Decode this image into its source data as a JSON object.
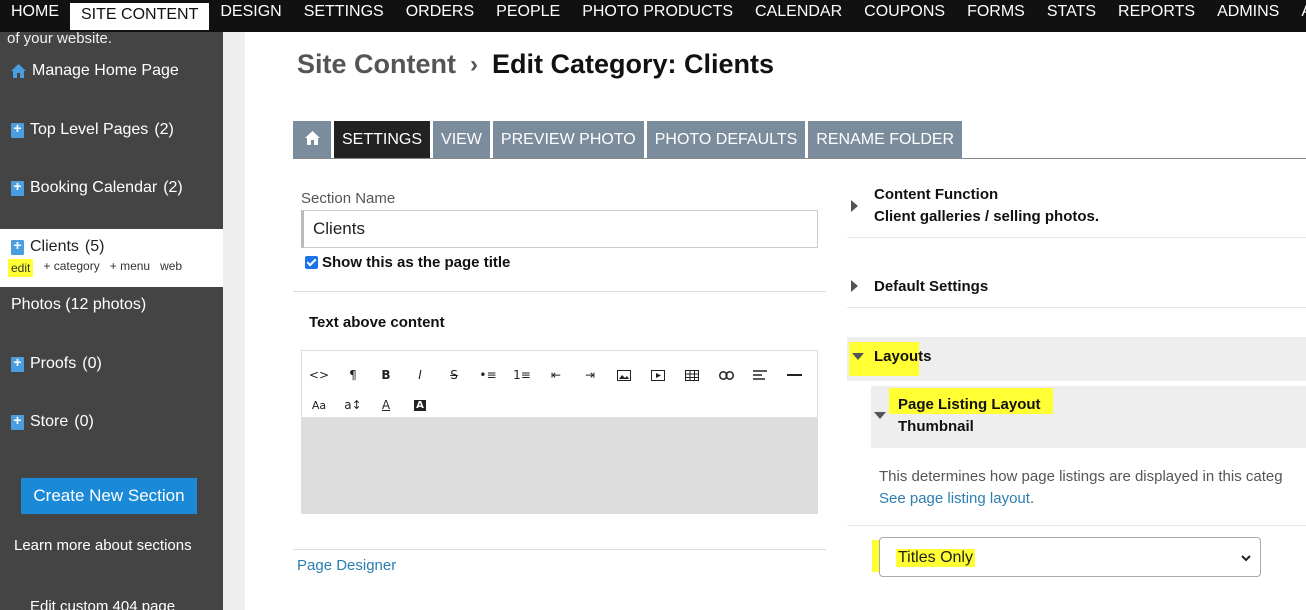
{
  "topnav": {
    "items": [
      "HOME",
      "SITE CONTENT",
      "DESIGN",
      "SETTINGS",
      "ORDERS",
      "PEOPLE",
      "PHOTO PRODUCTS",
      "CALENDAR",
      "COUPONS",
      "FORMS",
      "STATS",
      "REPORTS",
      "ADMINS",
      "ALL PI"
    ],
    "active_index": 1
  },
  "sidebar": {
    "intro": "of your website.",
    "manage_home": "Manage Home Page",
    "items": [
      {
        "label": "Top Level Pages",
        "count": "(2)"
      },
      {
        "label": "Booking Calendar",
        "count": "(2)"
      },
      {
        "label": "Clients",
        "count": "(5)"
      },
      {
        "label": "Photos (12 photos)",
        "count": ""
      },
      {
        "label": "Proofs",
        "count": "(0)"
      },
      {
        "label": "Store",
        "count": "(0)"
      }
    ],
    "active_actions": [
      "edit",
      "+ category",
      "+ menu",
      "web"
    ],
    "create_button": "Create New Section",
    "learn_more": "Learn more about sections",
    "edit_404": "Edit custom 404 page"
  },
  "breadcrumb": {
    "root": "Site Content",
    "separator": "›",
    "current": "Edit Category: Clients"
  },
  "tabs": [
    "SETTINGS",
    "VIEW",
    "PREVIEW PHOTO",
    "PHOTO DEFAULTS",
    "RENAME FOLDER"
  ],
  "form": {
    "section_name_label": "Section Name",
    "section_name_value": "Clients",
    "show_title_label": "Show this as the page title",
    "text_above_label": "Text above content",
    "page_designer": "Page Designer"
  },
  "editor_toolbar": [
    "<>",
    "¶",
    "B",
    "I",
    "S",
    "•≡",
    "1≡",
    "⇤",
    "⇥",
    "img",
    "▶",
    "▦",
    "🔗",
    "≡",
    "—",
    "Aa",
    "a↕",
    "A",
    "A"
  ],
  "right": {
    "content_function_title": "Content Function",
    "content_function_value": "Client galleries / selling photos.",
    "default_settings": "Default Settings",
    "layouts": "Layouts",
    "page_listing_layout": "Page Listing Layout",
    "page_listing_value": "Thumbnail",
    "description": "This determines how page listings are displayed in this categ",
    "link": "See page listing layout",
    "select_value": "Titles Only"
  },
  "colors": {
    "nav_bg": "#111111",
    "sidebar_bg": "#444444",
    "tab_bg": "#7b8c9c",
    "tab_active_bg": "#222222",
    "accent_blue": "#1a8ad8",
    "highlight": "#ffff33",
    "link": "#2a7fb0"
  }
}
